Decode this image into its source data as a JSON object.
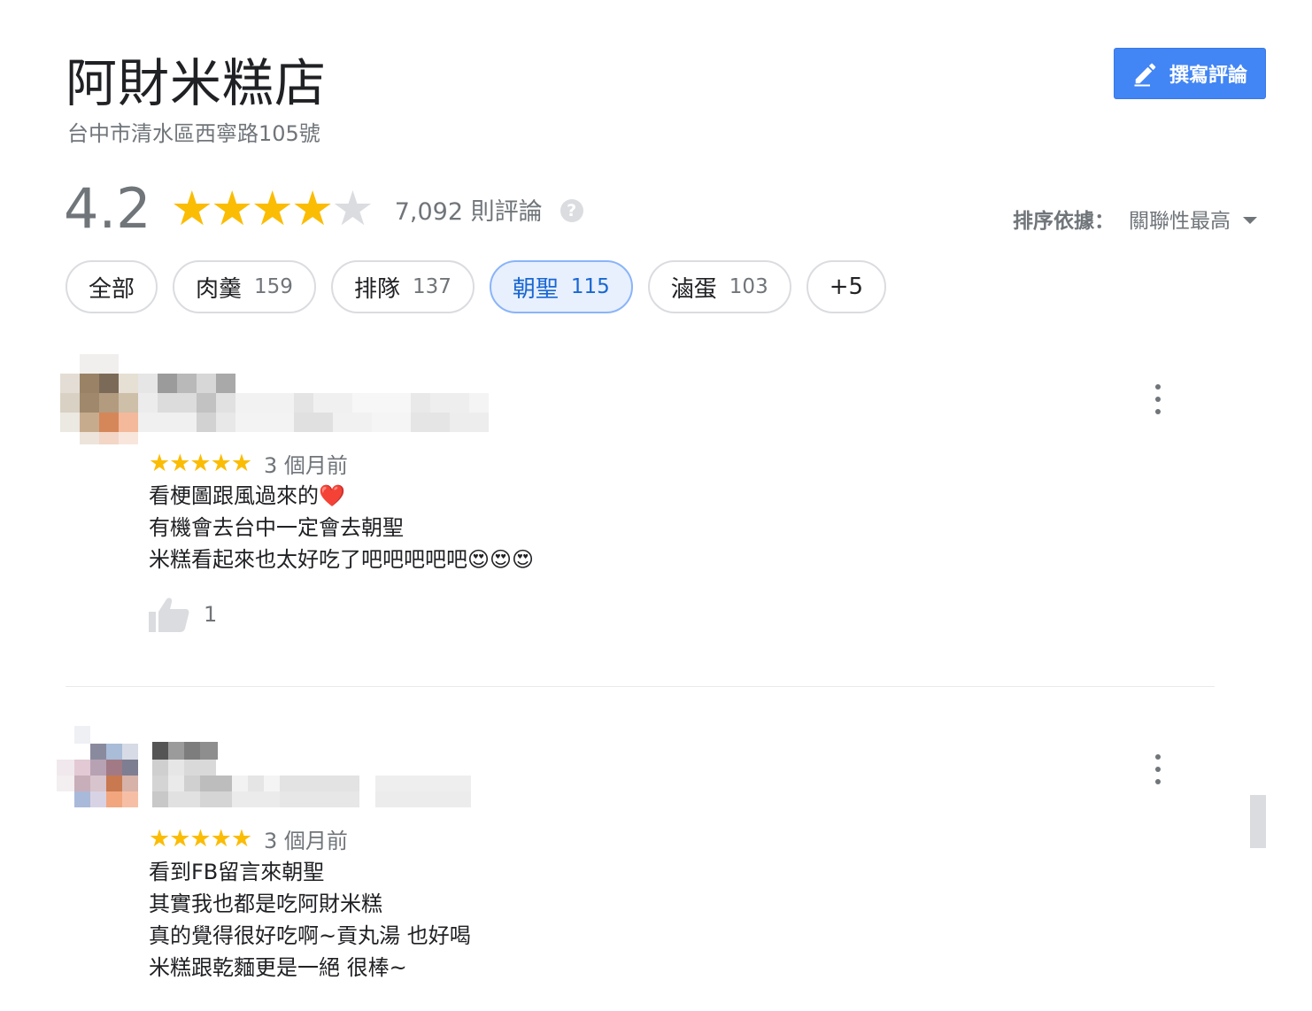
{
  "place": {
    "title": "阿財米糕店",
    "address": "台中市清水區西寧路105號"
  },
  "write_review": {
    "label": "撰寫評論"
  },
  "summary": {
    "rating": "4.2",
    "stars_filled": 4,
    "stars_total": 5,
    "review_count": "7,092 則評論",
    "help_icon": "?"
  },
  "sort": {
    "label": "排序依據：",
    "value": "關聯性最高"
  },
  "chips": [
    {
      "label": "全部",
      "count": ""
    },
    {
      "label": "肉羹",
      "count": "159"
    },
    {
      "label": "排隊",
      "count": "137"
    },
    {
      "label": "朝聖",
      "count": "115"
    },
    {
      "label": "滷蛋",
      "count": "103"
    },
    {
      "label": "+5",
      "count": ""
    }
  ],
  "reviews": [
    {
      "stars": "★★★★★",
      "date": "3 個月前",
      "lines": [
        "看梗圖跟風過來的❤️",
        "有機會去台中一定會去朝聖",
        "米糕看起來也太好吃了吧吧吧吧吧😍😍😍"
      ],
      "likes": "1"
    },
    {
      "stars": "★★★★★",
      "date": "3 個月前",
      "lines": [
        "看到FB留言來朝聖",
        "其實我也都是吃阿財米糕",
        "真的覺得很好吃啊~貢丸湯 也好喝",
        "米糕跟乾麵更是一絕 很棒~"
      ]
    }
  ],
  "colors": {
    "accent": "#4285f4",
    "star": "#fbbc04",
    "star_empty": "#dadce0",
    "chip_active_bg": "#e8f0fe",
    "chip_active_text": "#1967d2",
    "secondary_text": "#70757a"
  },
  "icons": {
    "write": "pencil-icon",
    "help": "help-icon",
    "sort": "dropdown-arrow-icon",
    "more": "more-vert-icon",
    "like": "thumb-up-icon"
  }
}
